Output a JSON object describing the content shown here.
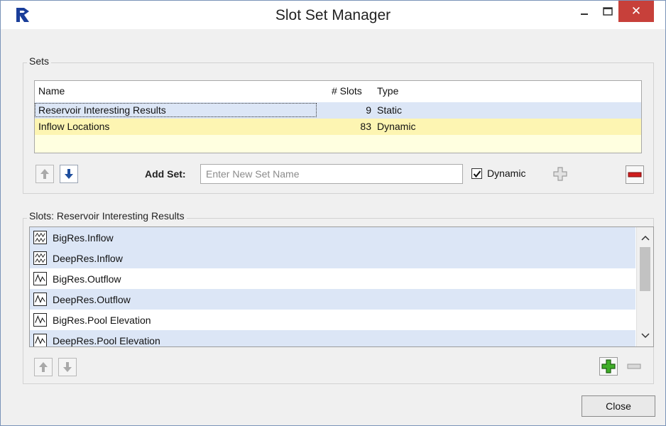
{
  "window": {
    "title": "Slot Set Manager",
    "minimize_label": "–",
    "close_label": "✕"
  },
  "sets": {
    "group_label": "Sets",
    "columns": [
      "Name",
      "# Slots",
      "Type"
    ],
    "rows": [
      {
        "name": "Reservoir Interesting Results",
        "slots": "9",
        "type": "Static"
      },
      {
        "name": "Inflow Locations",
        "slots": "83",
        "type": "Dynamic"
      }
    ],
    "add_set_label": "Add Set:",
    "add_set_placeholder": "Enter New Set Name",
    "add_set_value": "",
    "dynamic_label": "Dynamic",
    "dynamic_checked": true
  },
  "slots": {
    "group_label": "Slots: Reservoir Interesting Results",
    "items": [
      {
        "label": "BigRes.Inflow",
        "icon": "multi-series-icon"
      },
      {
        "label": "DeepRes.Inflow",
        "icon": "multi-series-icon"
      },
      {
        "label": "BigRes.Outflow",
        "icon": "series-icon"
      },
      {
        "label": "DeepRes.Outflow",
        "icon": "series-icon"
      },
      {
        "label": "BigRes.Pool Elevation",
        "icon": "series-icon"
      },
      {
        "label": "DeepRes.Pool Elevation",
        "icon": "series-icon"
      }
    ]
  },
  "footer": {
    "close_label": "Close"
  },
  "colors": {
    "selected_row": "#dce6f6",
    "dynamic_row": "#fdf5b2",
    "titlebar_close": "#c7403a",
    "add_green": "#3fae28",
    "remove_red": "#d01e1e",
    "arrow_blue": "#1f4f9e"
  }
}
